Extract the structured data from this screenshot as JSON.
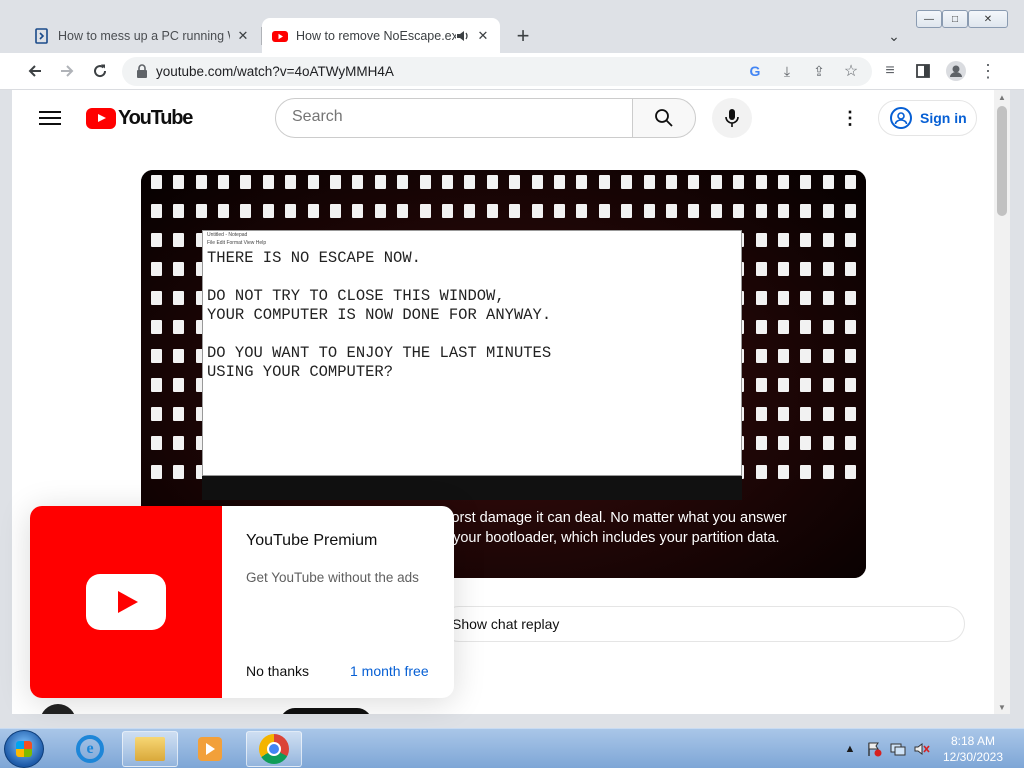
{
  "tabs": [
    {
      "title": "How to mess up a PC running Wi",
      "active": false
    },
    {
      "title": "How to remove NoEscape.exe",
      "active": true
    }
  ],
  "window_controls": {
    "minimize": "—",
    "maximize": "□",
    "close": "✕"
  },
  "address_bar": {
    "url": "youtube.com/watch?v=4oATWyMMH4A"
  },
  "youtube": {
    "logo_text": "YouTube",
    "search_placeholder": "Search",
    "sign_in_label": "Sign in"
  },
  "video": {
    "notepad_title": "Untitled - Notepad",
    "notepad_menu": "File   Edit   Format   View   Help",
    "notepad_text": "THERE IS NO ESCAPE NOW.\n\nDO NOT TRY TO CLOSE THIS WINDOW,\nYOUR COMPUTER IS NOW DONE FOR ANYWAY.\n\nDO YOU WANT TO ENJOY THE LAST MINUTES\nUSING YOUR COMPUTER?",
    "caption_line1": "worst damage it can deal. No matter what you answer",
    "caption_line2": "e your bootloader, which includes your partition data."
  },
  "chat_replay_label": "Show chat replay",
  "premium_promo": {
    "title": "YouTube Premium",
    "subtitle": "Get YouTube without the ads",
    "dismiss_label": "No thanks",
    "trial_label": "1 month free"
  },
  "taskbar": {
    "time": "8:18 AM",
    "date": "12/30/2023"
  },
  "colors": {
    "youtube_red": "#ff0000",
    "link_blue": "#065fd4",
    "chrome_frame": "#dee1e6"
  }
}
